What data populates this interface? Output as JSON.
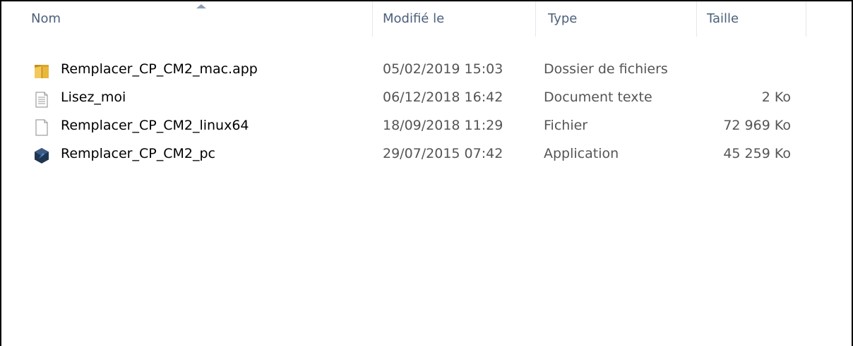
{
  "columns": {
    "name": "Nom",
    "modified": "Modifié le",
    "type": "Type",
    "size": "Taille"
  },
  "files": [
    {
      "icon": "folder-icon",
      "name": "Remplacer_CP_CM2_mac.app",
      "modified": "05/02/2019 15:03",
      "type": "Dossier de fichiers",
      "size": ""
    },
    {
      "icon": "text-document-icon",
      "name": "Lisez_moi",
      "modified": "06/12/2018 16:42",
      "type": "Document texte",
      "size": "2 Ko"
    },
    {
      "icon": "blank-file-icon",
      "name": "Remplacer_CP_CM2_linux64",
      "modified": "18/09/2018 11:29",
      "type": "Fichier",
      "size": "72 969 Ko"
    },
    {
      "icon": "application-icon",
      "name": "Remplacer_CP_CM2_pc",
      "modified": "29/07/2015 07:42",
      "type": "Application",
      "size": "45 259 Ko"
    }
  ],
  "colors": {
    "header_text": "#4c607a",
    "folder": "#e8b83d",
    "app_icon": "#1f3550"
  }
}
